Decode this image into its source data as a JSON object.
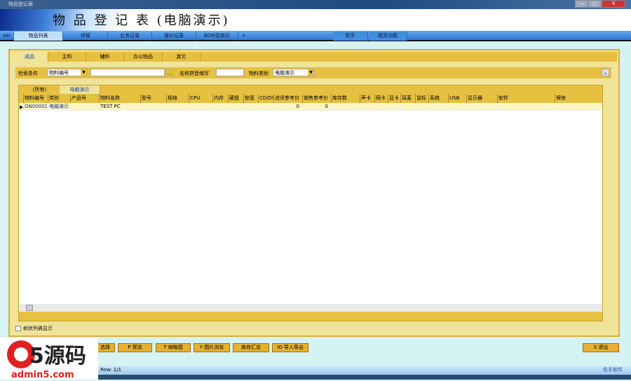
{
  "window": {
    "title": "物品登记表",
    "min": "—",
    "max": "□",
    "close": "X"
  },
  "header": {
    "title": "物 品 登 记 表 (电脑演示)"
  },
  "nav": {
    "items": [
      "AH",
      "物品列表",
      "详细",
      "业务记录",
      "报价记录",
      "BOM及核价",
      "+",
      "佐手",
      "相关功能"
    ]
  },
  "tabs": [
    "成品",
    "主料",
    "辅料",
    "办公物品",
    "其它"
  ],
  "search": {
    "cond_label": "检索条件",
    "cond_value": "物料编号",
    "text_value": "",
    "browse": "...",
    "pinyin_label": "名称拼音缩写",
    "pinyin_value": "",
    "cat_label": "物料类别",
    "cat_value": "电脑演示"
  },
  "grid": {
    "tabs": [
      "(所有)",
      "电脑演示"
    ],
    "columns": [
      "物料编号",
      "类别",
      "产品号",
      "物料名称",
      "型号",
      "规格",
      "CPU",
      "内存",
      "硬盘",
      "软驱",
      "CD/DVD",
      "进货参考价",
      "销售参考价",
      "库存数",
      "声卡",
      "网卡",
      "显卡",
      "耳麦",
      "鼠标",
      "系统",
      "USB",
      "显示器",
      "软件",
      "保修"
    ],
    "rows": [
      [
        "DN00001",
        "电脑演示",
        "",
        "TEST PC",
        "",
        "",
        "",
        "",
        "",
        "",
        "",
        "0",
        "0",
        "",
        "",
        "",
        "",
        "",
        "",
        "",
        "",
        "",
        "",
        ""
      ]
    ]
  },
  "tree_checkbox": {
    "label": "树状列表显示",
    "checked": false
  },
  "buttons": [
    "选择",
    "P 预览",
    "T 缩略图",
    "Y 图片浏览",
    "库存汇总",
    "IO 导入导出",
    "X 退出"
  ],
  "status": {
    "row": "Row: 1/1",
    "brand": "佐手软件"
  },
  "watermark": {
    "logo": "a5源码",
    "url": "admin5.com"
  }
}
